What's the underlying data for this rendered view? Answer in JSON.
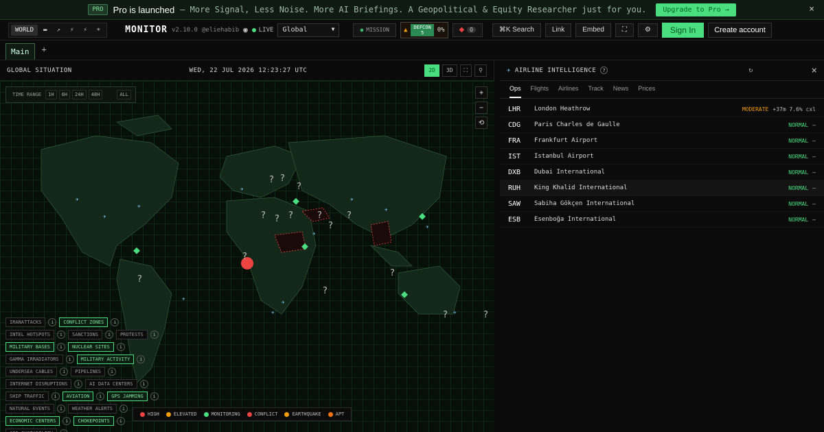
{
  "banner": {
    "pro_badge": "PRO",
    "title": "Pro is launched",
    "subtitle": "– More Signal, Less Noise. More AI Briefings. A Geopolitical & Equity Researcher just for you.",
    "upgrade": "Upgrade to Pro →",
    "close": "×"
  },
  "topbar": {
    "variant_tabs": [
      "WORLD",
      "▬",
      "↗",
      "⚡",
      "⚡",
      "☀"
    ],
    "logo": "MONITOR",
    "version": "v2.10.0",
    "author": "@eliehabib",
    "live": "LIVE",
    "region": "Global",
    "mission": "MISSION",
    "defcon_label": "DEFCON",
    "defcon_level": "5",
    "defcon_pct": "0%",
    "alerts": "0",
    "search": "⌘K Search",
    "link": "Link",
    "embed": "Embed",
    "signin": "Sign In",
    "create": "Create account"
  },
  "tabs": {
    "main": "Main",
    "add": "+"
  },
  "map": {
    "title": "GLOBAL SITUATION",
    "datetime": "WED, 22 JUL 2026 12:23:27 UTC",
    "mode_2d": "2D",
    "mode_3d": "3D",
    "time_range": {
      "label": "TIME RANGE",
      "options": [
        "1H",
        "6H",
        "24H",
        "48H",
        "ALL"
      ]
    },
    "zoom": [
      "+",
      "−",
      "⟲"
    ],
    "layers": [
      [
        {
          "label": "IRANATTACKS",
          "on": false
        },
        {
          "label": "CONFLICT ZONES",
          "on": true
        }
      ],
      [
        {
          "label": "INTEL HOTSPOTS",
          "on": false
        },
        {
          "label": "SANCTIONS",
          "on": false
        },
        {
          "label": "PROTESTS",
          "on": false
        }
      ],
      [
        {
          "label": "MILITARY BASES",
          "on": true
        },
        {
          "label": "NUCLEAR SITES",
          "on": true
        }
      ],
      [
        {
          "label": "GAMMA IRRADIATORS",
          "on": false
        },
        {
          "label": "MILITARY ACTIVITY",
          "on": true
        }
      ],
      [
        {
          "label": "UNDERSEA CABLES",
          "on": false
        },
        {
          "label": "PIPELINES",
          "on": false
        }
      ],
      [
        {
          "label": "INTERNET DISRUPTIONS",
          "on": false
        },
        {
          "label": "AI DATA CENTERS",
          "on": false
        }
      ],
      [
        {
          "label": "SHIP TRAFFIC",
          "on": false
        },
        {
          "label": "AVIATION",
          "on": true
        },
        {
          "label": "GPS JAMMING",
          "on": true
        }
      ],
      [
        {
          "label": "NATURAL EVENTS",
          "on": false
        },
        {
          "label": "WEATHER ALERTS",
          "on": false
        }
      ],
      [
        {
          "label": "ECONOMIC CENTERS",
          "on": true
        },
        {
          "label": "CHOKEPOINTS",
          "on": true
        }
      ],
      [
        {
          "label": "CII INSTABILITY",
          "on": false
        }
      ]
    ],
    "legend": [
      {
        "label": "HIGH",
        "color": "#ef4444"
      },
      {
        "label": "ELEVATED",
        "color": "#f59e0b"
      },
      {
        "label": "MONITORING",
        "color": "#4ade80"
      },
      {
        "label": "CONFLICT",
        "color": "#ef4444"
      },
      {
        "label": "EARTHQUAKE",
        "color": "#f59e0b"
      },
      {
        "label": "APT",
        "color": "#f97316"
      }
    ]
  },
  "airline": {
    "title": "AIRLINE INTELLIGENCE",
    "help": "?",
    "refresh": "↻",
    "close": "×",
    "tabs": [
      "Ops",
      "Flights",
      "Airlines",
      "Track",
      "News",
      "Prices"
    ],
    "rows": [
      {
        "code": "LHR",
        "name": "London Heathrow",
        "status": "MODERATE",
        "extra": "+37m 7.6% cxl"
      },
      {
        "code": "CDG",
        "name": "Paris Charles de Gaulle",
        "status": "NORMAL",
        "extra": "–"
      },
      {
        "code": "FRA",
        "name": "Frankfurt Airport",
        "status": "NORMAL",
        "extra": "–"
      },
      {
        "code": "IST",
        "name": "Istanbul Airport",
        "status": "NORMAL",
        "extra": "–"
      },
      {
        "code": "DXB",
        "name": "Dubai International",
        "status": "NORMAL",
        "extra": "–"
      },
      {
        "code": "RUH",
        "name": "King Khalid International",
        "status": "NORMAL",
        "extra": "–"
      },
      {
        "code": "SAW",
        "name": "Sabiha Gökçen International",
        "status": "NORMAL",
        "extra": "–"
      },
      {
        "code": "ESB",
        "name": "Esenboğa International",
        "status": "NORMAL",
        "extra": "–"
      }
    ]
  }
}
